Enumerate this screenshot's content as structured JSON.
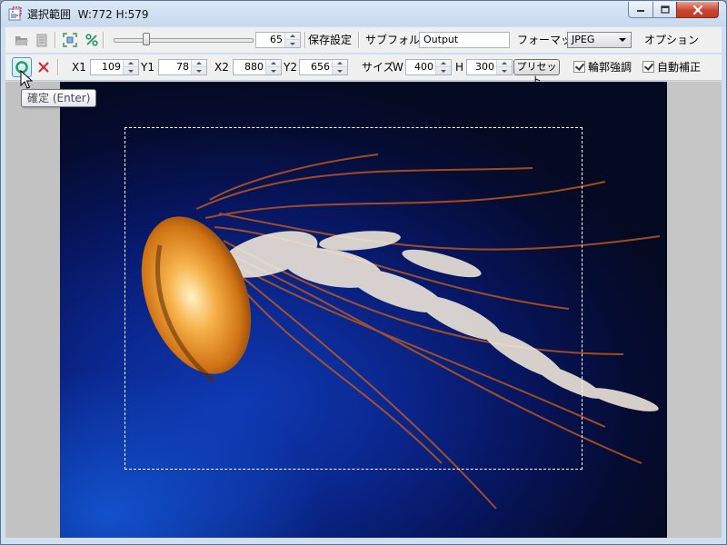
{
  "window": {
    "title": "選択範囲",
    "dimensions": "W:772 H:579"
  },
  "toolbar1": {
    "quality_value": "65",
    "quality_level": 0.24,
    "save_settings_label": "保存設定",
    "subfolder_label": "サブフォルダ",
    "subfolder_value": "Output",
    "format_label": "フォーマット",
    "format_value": "JPEG",
    "options_label": "オプション"
  },
  "toolbar2": {
    "x1_label": "X1",
    "x1_value": "109",
    "y1_label": "Y1",
    "y1_value": "78",
    "x2_label": "X2",
    "x2_value": "880",
    "y2_label": "Y2",
    "y2_value": "656",
    "size_label": "サイズ",
    "w_label": "W",
    "w_value": "400",
    "h_label": "H",
    "h_value": "300",
    "preset_label": "プリセット",
    "edge_enhance_label": "輪郭強調",
    "edge_enhance_checked": true,
    "auto_correct_label": "自動補正",
    "auto_correct_checked": true
  },
  "tooltip": {
    "text": "確定 (Enter)"
  },
  "colors": {
    "confirm_icon": "#1fa35a",
    "cancel_icon": "#d4232b",
    "close_button": "#c9452f",
    "title_bar": "#c7d9ee"
  },
  "icons": [
    "app-icon",
    "open-folder-icon",
    "document-icon",
    "fit-icon",
    "percent-icon",
    "confirm-icon",
    "cancel-icon",
    "minimize-icon",
    "maximize-icon",
    "close-icon"
  ]
}
